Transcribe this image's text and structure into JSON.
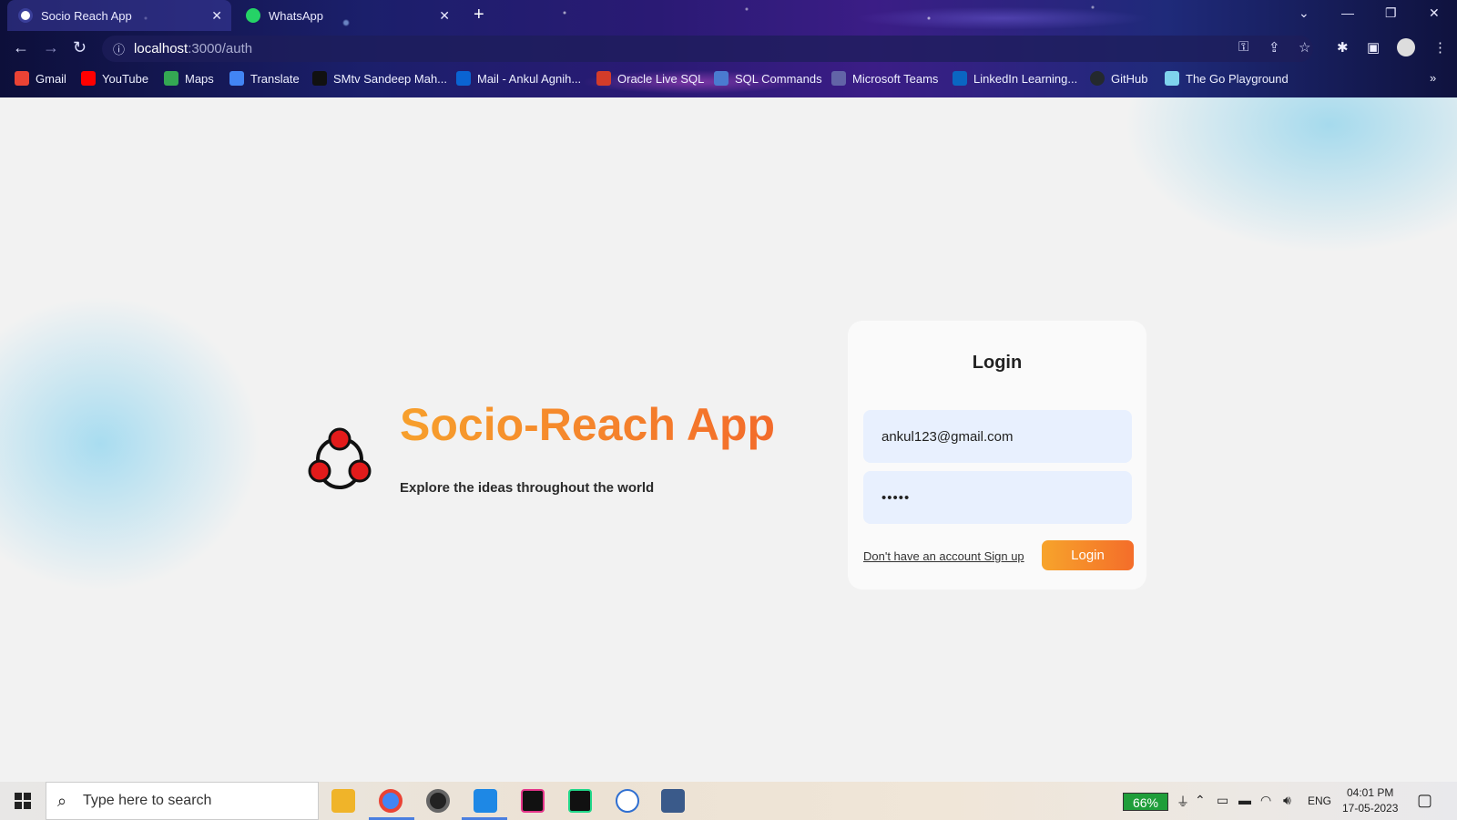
{
  "browser": {
    "tabs": [
      {
        "title": "Socio Reach App",
        "active": true
      },
      {
        "title": "WhatsApp",
        "active": false
      }
    ],
    "url_host": "localhost",
    "url_path": ":3000/auth",
    "bookmarks": [
      {
        "label": "Gmail",
        "color": "#ea4335"
      },
      {
        "label": "YouTube",
        "color": "#ff0000"
      },
      {
        "label": "Maps",
        "color": "#34a853"
      },
      {
        "label": "Translate",
        "color": "#4285f4"
      },
      {
        "label": "SMtv Sandeep Mah...",
        "color": "#111111"
      },
      {
        "label": "Mail - Ankul Agnih...",
        "color": "#0a64d2"
      },
      {
        "label": "Oracle Live SQL",
        "color": "#d33c2a"
      },
      {
        "label": "SQL Commands",
        "color": "#4a7bd0"
      },
      {
        "label": "Microsoft Teams",
        "color": "#6264a7"
      },
      {
        "label": "LinkedIn Learning...",
        "color": "#0a66c2"
      },
      {
        "label": "GitHub",
        "color": "#24292e"
      },
      {
        "label": "The Go Playground",
        "color": "#7fd3ed"
      }
    ],
    "more_bookmarks": "»"
  },
  "app": {
    "title": "Socio-Reach App",
    "tagline": "Explore the ideas throughout the world"
  },
  "login": {
    "heading": "Login",
    "email_value": "ankul123@gmail.com",
    "password_value": "•••••",
    "signup_text": "Don't have an account Sign up",
    "button_label": "Login",
    "accent": "#f48a2b"
  },
  "taskbar": {
    "search_placeholder": "Type here to search",
    "battery": "66%",
    "language": "ENG",
    "time": "04:01 PM",
    "date": "17-05-2023"
  }
}
